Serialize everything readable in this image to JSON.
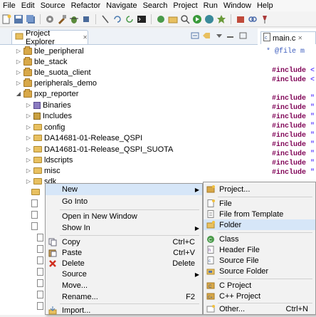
{
  "menubar": [
    "File",
    "Edit",
    "Source",
    "Refactor",
    "Navigate",
    "Search",
    "Project",
    "Run",
    "Window",
    "Help"
  ],
  "project_explorer": {
    "tab_title": "Project Explorer",
    "close_glyph": "✕"
  },
  "tree": [
    {
      "label": "ble_peripheral",
      "icon": "project-icon"
    },
    {
      "label": "ble_stack",
      "icon": "project-icon"
    },
    {
      "label": "ble_suota_client",
      "icon": "project-icon"
    },
    {
      "label": "peripherals_demo",
      "icon": "project-icon"
    },
    {
      "label": "pxp_reporter",
      "icon": "project-icon"
    },
    {
      "label": "Binaries",
      "icon": "binaries-icon"
    },
    {
      "label": "Includes",
      "icon": "includes-icon"
    },
    {
      "label": "config",
      "icon": "folder-icon"
    },
    {
      "label": "DA14681-01-Release_QSPI",
      "icon": "folder-icon"
    },
    {
      "label": "DA14681-01-Release_QSPI_SUOTA",
      "icon": "folder-icon"
    },
    {
      "label": "ldscripts",
      "icon": "folder-icon"
    },
    {
      "label": "misc",
      "icon": "folder-icon"
    },
    {
      "label": "sdk",
      "icon": "folder-icon"
    }
  ],
  "editor": {
    "tab_title": "main.c",
    "close_glyph": "✕",
    "file_comment": "* @file m",
    "include_kw": "#include",
    "quote_angle": "<",
    "quote_dbl": "\""
  },
  "context_menu": {
    "new": "New",
    "go_into": "Go Into",
    "open_new_window": "Open in New Window",
    "show_in": "Show In",
    "copy": "Copy",
    "copy_sc": "Ctrl+C",
    "paste": "Paste",
    "paste_sc": "Ctrl+V",
    "delete": "Delete",
    "delete_sc": "Delete",
    "source": "Source",
    "move": "Move...",
    "rename": "Rename...",
    "rename_sc": "F2",
    "import": "Import..."
  },
  "submenu": {
    "project": "Project...",
    "file": "File",
    "file_from_template": "File from Template",
    "folder": "Folder",
    "class": "Class",
    "header_file": "Header File",
    "source_file": "Source File",
    "source_folder": "Source Folder",
    "c_project": "C Project",
    "cpp_project": "C++ Project",
    "other": "Other...",
    "other_sc": "Ctrl+N"
  },
  "colors": {
    "highlight": "#d6e6f8",
    "keyword": "#7f0055",
    "string": "#2a00ff"
  }
}
